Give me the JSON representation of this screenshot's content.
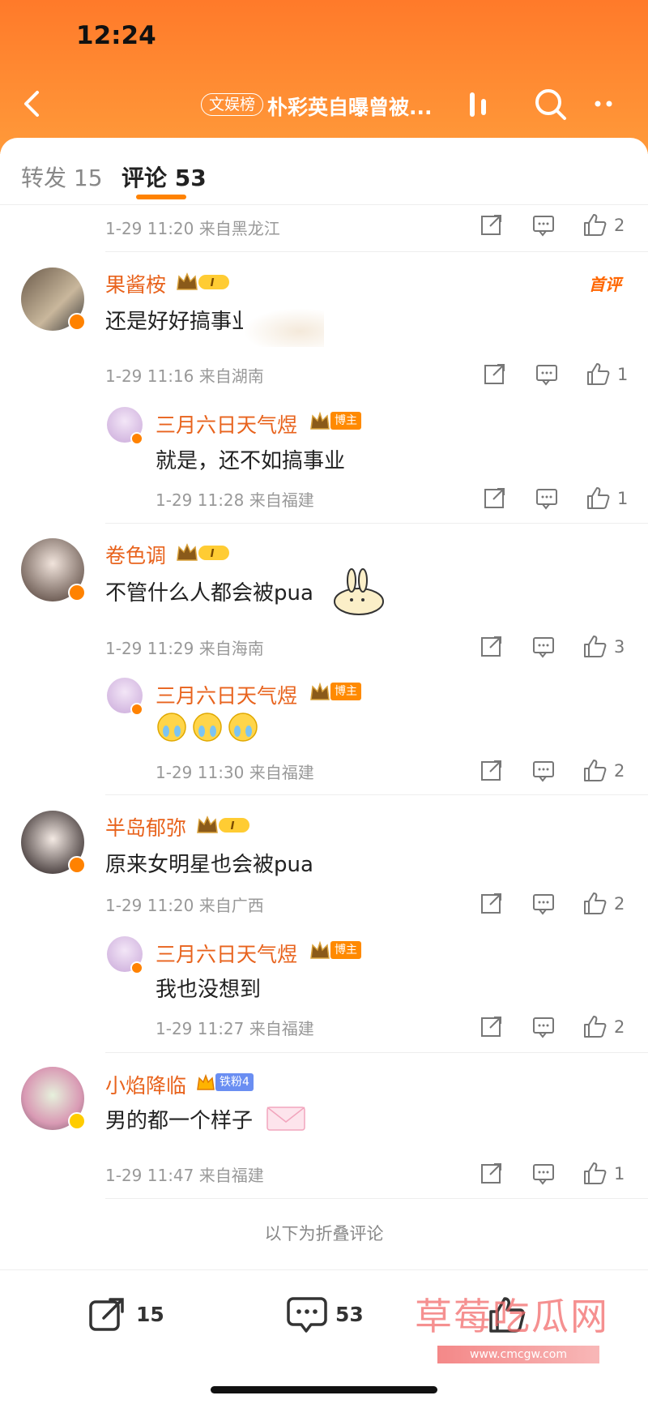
{
  "status_bar": {
    "time": "12:24"
  },
  "header": {
    "topic_badge": "文娱榜",
    "title": "朴彩英自曝曾被...",
    "accent": "#ff8200"
  },
  "tabs": [
    {
      "label": "转发 15",
      "active": false
    },
    {
      "label": "评论 53",
      "active": true
    }
  ],
  "top_meta": {
    "text": "1-29 11:20 来自黑龙江",
    "likes": "2"
  },
  "comments": [
    {
      "name": "果酱桉",
      "level": "I",
      "badge": "首评",
      "text": "还是好好搞事业",
      "meta": "1-29 11:16 来自湖南",
      "likes": "1",
      "reply": {
        "name": "三月六日天气煜",
        "tag": "博主",
        "text": "就是，还不如搞事业",
        "meta": "1-29 11:28 来自福建",
        "likes": "1"
      }
    },
    {
      "name": "卷色调",
      "level": "I",
      "text": "不管什么人都会被pua",
      "meta": "1-29 11:29 来自海南",
      "likes": "3",
      "reply": {
        "name": "三月六日天气煜",
        "tag": "博主",
        "text": "",
        "meta": "1-29 11:30 来自福建",
        "likes": "2"
      }
    },
    {
      "name": "半岛郁弥",
      "level": "I",
      "text": "原来女明星也会被pua",
      "meta": "1-29 11:20 来自广西",
      "likes": "2",
      "reply": {
        "name": "三月六日天气煜",
        "tag": "博主",
        "text": "我也没想到",
        "meta": "1-29 11:27 来自福建",
        "likes": "2"
      }
    },
    {
      "name": "小焰降临",
      "fan_tag": "铁粉4",
      "text": "男的都一个样子",
      "meta": "1-29 11:47 来自福建",
      "likes": "1"
    }
  ],
  "folded_text": "以下为折叠评论",
  "bottom_bar": {
    "repost_count": "15",
    "comment_count": "53"
  },
  "watermark": {
    "text": "草莓吃瓜网",
    "url": "www.cmcgw.com"
  },
  "icons": {
    "back": "back-arrow-icon",
    "share": "share-icon",
    "comment": "comment-icon",
    "like": "thumbs-up-icon",
    "search": "search-icon",
    "more": "more-icon"
  }
}
